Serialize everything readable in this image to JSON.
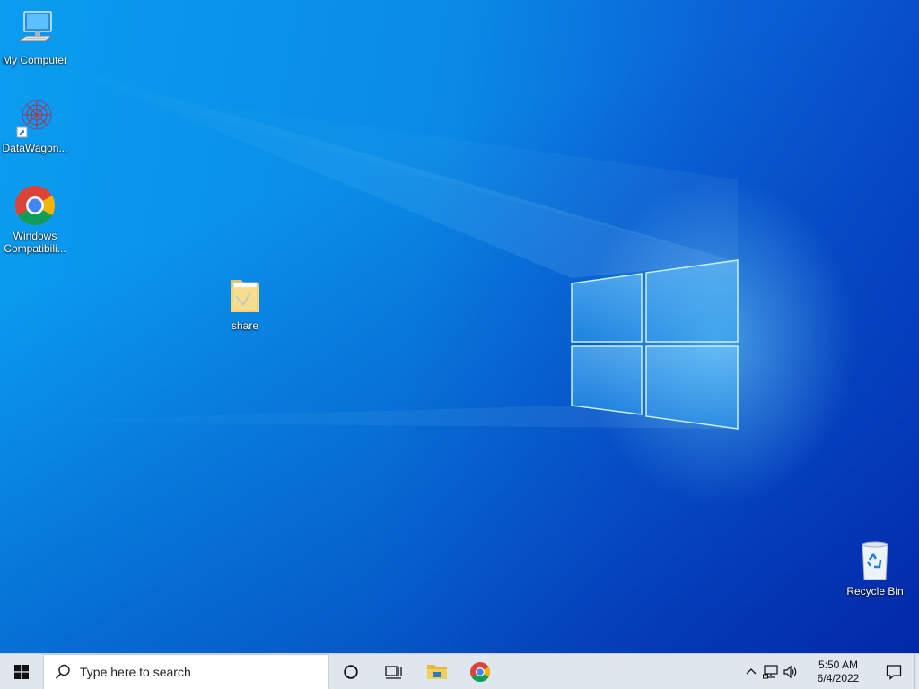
{
  "desktop": {
    "icons": {
      "my_computer": "My Computer",
      "datawagon": "DataWagon...",
      "chrome_line1": "Windows",
      "chrome_line2": "Compatibili...",
      "share": "share",
      "recycle_bin": "Recycle Bin"
    }
  },
  "taskbar": {
    "search_placeholder": "Type here to search",
    "apps": [
      "cortana-icon",
      "task-view-icon",
      "file-explorer-icon",
      "chrome-icon"
    ],
    "clock": {
      "time": "5:50 AM",
      "date": "6/4/2022"
    }
  },
  "colors": {
    "wallpaper_accent": "#0a8ae6",
    "taskbar_bg": "#dfe6ee",
    "chrome_red": "#db4437",
    "chrome_green": "#0f9d58",
    "chrome_yellow": "#f4b400",
    "chrome_blue": "#4285f4"
  }
}
